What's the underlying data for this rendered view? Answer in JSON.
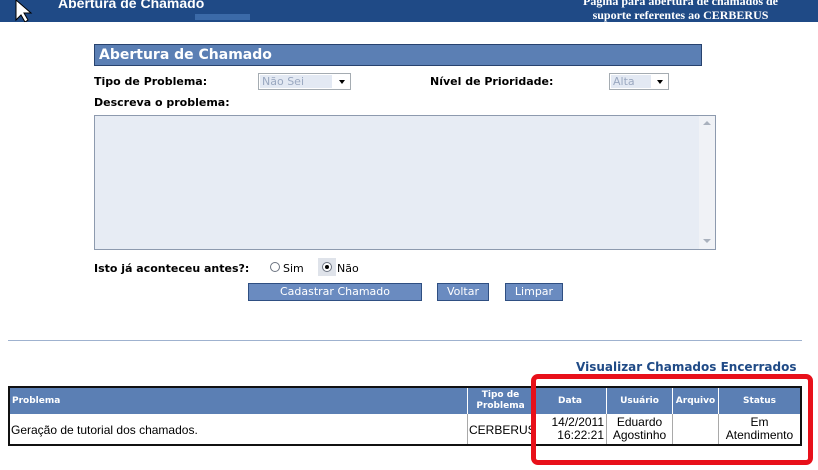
{
  "header": {
    "title": "Abertura de Chamado",
    "subtitle_line1": "Página para abertura de chamados de",
    "subtitle_line2": "suporte referentes ao CERBERUS"
  },
  "form": {
    "title": "Abertura de Chamado",
    "problem_type_label": "Tipo de Problema:",
    "problem_type_value": "Não Sei",
    "priority_label": "Nível de Prioridade:",
    "priority_value": "Alta",
    "description_label": "Descreva o problema:",
    "description_value": "",
    "happened_before_label": "Isto já aconteceu antes?:",
    "option_yes": "Sim",
    "option_no": "Não",
    "selected_option": "Não",
    "submit_button": "Cadastrar Chamado",
    "back_button": "Voltar",
    "clear_button": "Limpar"
  },
  "closed_tickets_link": "Visualizar Chamados Encerrados",
  "table": {
    "columns": {
      "problem": "Problema",
      "type_line1": "Tipo de",
      "type_line2": "Problema",
      "date": "Data",
      "user": "Usuário",
      "file": "Arquivo",
      "status": "Status"
    },
    "rows": [
      {
        "problem": "Geração de tutorial dos chamados.",
        "type": "CERBERUS",
        "date_line1": "14/2/2011",
        "date_line2": "16:22:21",
        "user_line1": "Eduardo",
        "user_line2": "Agostinho",
        "file": "",
        "status_line1": "Em",
        "status_line2": "Atendimento"
      }
    ]
  },
  "colors": {
    "header_bg": "#1f4a86",
    "accent_blue": "#5b7fb4",
    "highlight_red": "#e8101a"
  }
}
